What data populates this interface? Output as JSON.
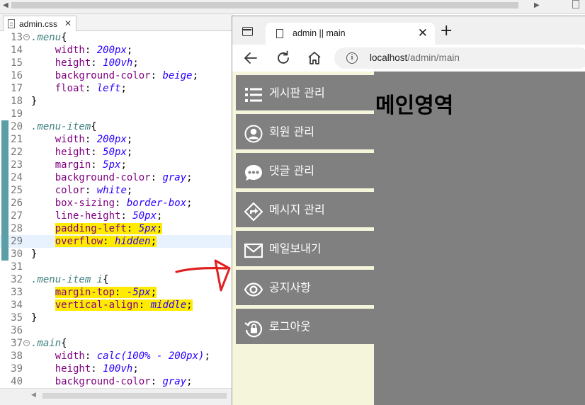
{
  "ide": {
    "file_tab": "admin.css",
    "lines": [
      {
        "n": "13",
        "fold": true,
        "parts": [
          [
            "sel",
            ".menu"
          ],
          [
            "",
            "{"
          ]
        ]
      },
      {
        "n": "14",
        "parts": [
          [
            "",
            "    "
          ],
          [
            "prop",
            "width"
          ],
          [
            "",
            ": "
          ],
          [
            "val",
            "200px"
          ],
          [
            "",
            ";"
          ]
        ]
      },
      {
        "n": "15",
        "parts": [
          [
            "",
            "    "
          ],
          [
            "prop",
            "height"
          ],
          [
            "",
            ": "
          ],
          [
            "val",
            "100vh"
          ],
          [
            "",
            ";"
          ]
        ]
      },
      {
        "n": "16",
        "parts": [
          [
            "",
            "    "
          ],
          [
            "prop",
            "background-color"
          ],
          [
            "",
            ": "
          ],
          [
            "val",
            "beige"
          ],
          [
            "",
            ";"
          ]
        ]
      },
      {
        "n": "17",
        "parts": [
          [
            "",
            "    "
          ],
          [
            "prop",
            "float"
          ],
          [
            "",
            ": "
          ],
          [
            "val",
            "left"
          ],
          [
            "",
            ";"
          ]
        ]
      },
      {
        "n": "18",
        "parts": [
          [
            "",
            "}"
          ]
        ]
      },
      {
        "n": "19",
        "parts": []
      },
      {
        "n": "20",
        "mark": true,
        "parts": [
          [
            "sel",
            ".menu-item"
          ],
          [
            "",
            "{"
          ]
        ]
      },
      {
        "n": "21",
        "mark": true,
        "parts": [
          [
            "",
            "    "
          ],
          [
            "prop",
            "width"
          ],
          [
            "",
            ": "
          ],
          [
            "val",
            "200px"
          ],
          [
            "",
            ";"
          ]
        ]
      },
      {
        "n": "22",
        "mark": true,
        "parts": [
          [
            "",
            "    "
          ],
          [
            "prop",
            "height"
          ],
          [
            "",
            ": "
          ],
          [
            "val",
            "50px"
          ],
          [
            "",
            ";"
          ]
        ]
      },
      {
        "n": "23",
        "mark": true,
        "parts": [
          [
            "",
            "    "
          ],
          [
            "prop",
            "margin"
          ],
          [
            "",
            ": "
          ],
          [
            "val",
            "5px"
          ],
          [
            "",
            ";"
          ]
        ]
      },
      {
        "n": "24",
        "mark": true,
        "parts": [
          [
            "",
            "    "
          ],
          [
            "prop",
            "background-color"
          ],
          [
            "",
            ": "
          ],
          [
            "val",
            "gray"
          ],
          [
            "",
            ";"
          ]
        ]
      },
      {
        "n": "25",
        "mark": true,
        "parts": [
          [
            "",
            "    "
          ],
          [
            "prop",
            "color"
          ],
          [
            "",
            ": "
          ],
          [
            "val",
            "white"
          ],
          [
            "",
            ";"
          ]
        ]
      },
      {
        "n": "26",
        "mark": true,
        "parts": [
          [
            "",
            "    "
          ],
          [
            "prop",
            "box-sizing"
          ],
          [
            "",
            ": "
          ],
          [
            "val",
            "border-box"
          ],
          [
            "",
            ";"
          ]
        ]
      },
      {
        "n": "27",
        "mark": true,
        "parts": [
          [
            "",
            "    "
          ],
          [
            "prop",
            "line-height"
          ],
          [
            "",
            ": "
          ],
          [
            "val",
            "50px"
          ],
          [
            "",
            ";"
          ]
        ]
      },
      {
        "n": "28",
        "mark": true,
        "hl": true,
        "parts": [
          [
            "",
            "    "
          ],
          [
            "prop",
            "padding-left"
          ],
          [
            "",
            ": "
          ],
          [
            "val",
            "5px"
          ],
          [
            "",
            ";"
          ]
        ]
      },
      {
        "n": "29",
        "mark": true,
        "hl": true,
        "current": true,
        "parts": [
          [
            "",
            "    "
          ],
          [
            "prop",
            "overflow"
          ],
          [
            "",
            ": "
          ],
          [
            "val",
            "hidden"
          ],
          [
            "",
            ";"
          ]
        ]
      },
      {
        "n": "30",
        "mark": true,
        "parts": [
          [
            "",
            "}"
          ]
        ]
      },
      {
        "n": "31",
        "parts": []
      },
      {
        "n": "32",
        "parts": [
          [
            "sel",
            ".menu-item i"
          ],
          [
            "",
            "{"
          ]
        ]
      },
      {
        "n": "33",
        "hl": true,
        "parts": [
          [
            "",
            "    "
          ],
          [
            "prop",
            "margin-top"
          ],
          [
            "",
            ": "
          ],
          [
            "val",
            "-5px"
          ],
          [
            "",
            ";"
          ]
        ]
      },
      {
        "n": "34",
        "hl": true,
        "parts": [
          [
            "",
            "    "
          ],
          [
            "prop",
            "vertical-align"
          ],
          [
            "",
            ": "
          ],
          [
            "val",
            "middle"
          ],
          [
            "",
            ";"
          ]
        ]
      },
      {
        "n": "35",
        "parts": [
          [
            "",
            "}"
          ]
        ]
      },
      {
        "n": "36",
        "parts": []
      },
      {
        "n": "37",
        "fold": true,
        "parts": [
          [
            "sel",
            ".main"
          ],
          [
            "",
            "{"
          ]
        ]
      },
      {
        "n": "38",
        "parts": [
          [
            "",
            "    "
          ],
          [
            "prop",
            "width"
          ],
          [
            "",
            ": "
          ],
          [
            "val",
            "calc(100% - 200px)"
          ],
          [
            "",
            ";"
          ]
        ]
      },
      {
        "n": "39",
        "parts": [
          [
            "",
            "    "
          ],
          [
            "prop",
            "height"
          ],
          [
            "",
            ": "
          ],
          [
            "val",
            "100vh"
          ],
          [
            "",
            ";"
          ]
        ]
      },
      {
        "n": "40",
        "parts": [
          [
            "",
            "    "
          ],
          [
            "prop",
            "background-color"
          ],
          [
            "",
            ": "
          ],
          [
            "val",
            "gray"
          ],
          [
            "",
            ";"
          ]
        ]
      }
    ]
  },
  "browser": {
    "tab_title": "admin || main",
    "url_host": "localhost",
    "url_path": "/admin/main",
    "menu": [
      {
        "label": "게시판 관리",
        "icon": "list-icon"
      },
      {
        "label": "회원 관리",
        "icon": "user-circle-icon"
      },
      {
        "label": "댓글 관리",
        "icon": "comment-dots-icon"
      },
      {
        "label": "메시지 관리",
        "icon": "directions-sign-icon"
      },
      {
        "label": "메일보내기",
        "icon": "envelope-icon"
      },
      {
        "label": "공지사항",
        "icon": "eye-icon"
      },
      {
        "label": "로그아웃",
        "icon": "lock-reset-icon"
      }
    ],
    "main_title": "메인영역"
  },
  "colors": {
    "menu_bg": "#f5f5dc",
    "menu_item_bg": "#808080",
    "main_bg": "#808080",
    "highlight": "#ffeb00",
    "annotation_arrow": "#e02020"
  }
}
